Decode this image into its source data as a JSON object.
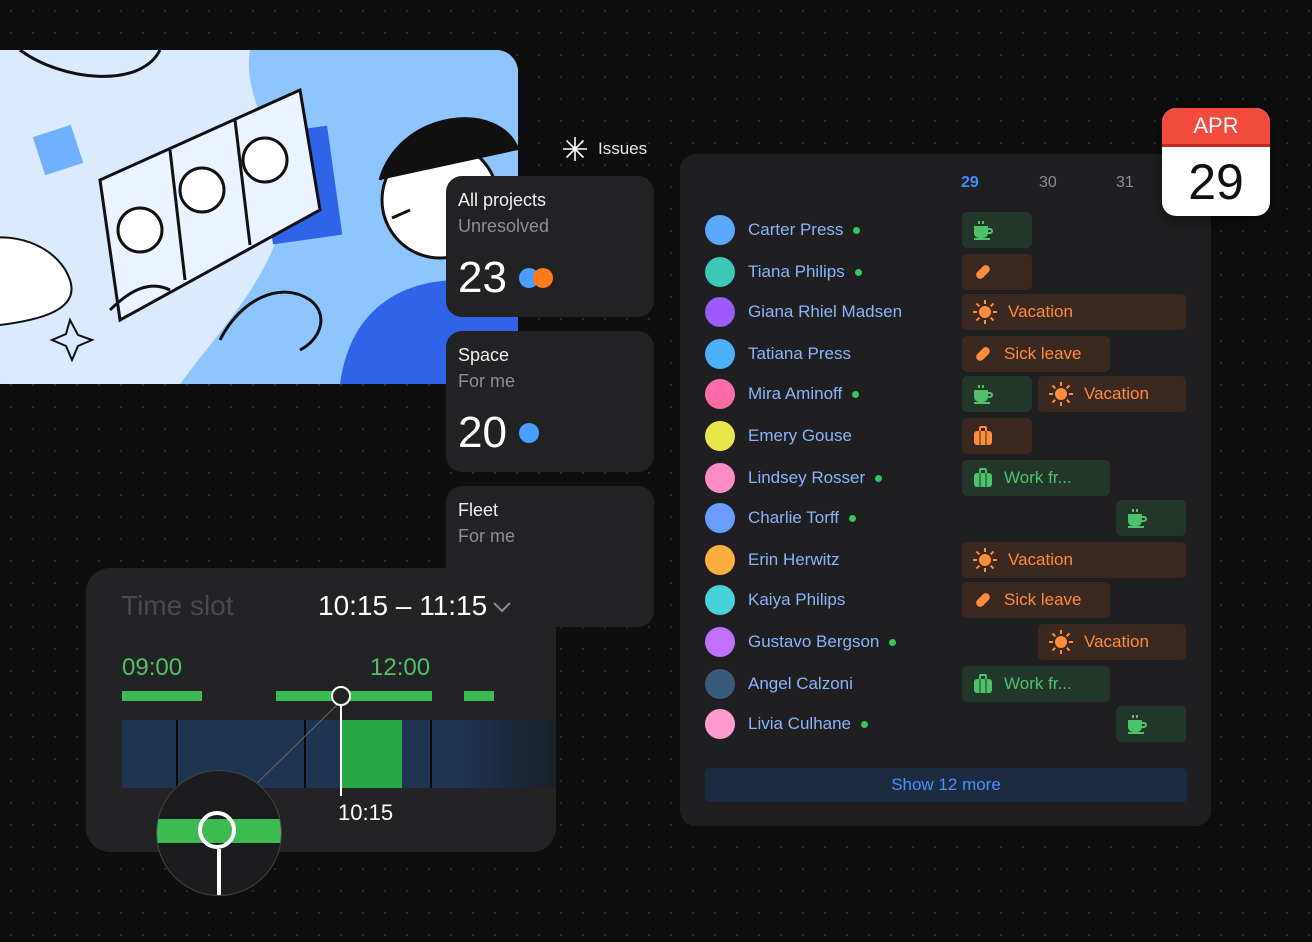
{
  "issues": {
    "label": "Issues",
    "cards": [
      {
        "title": "All projects",
        "subtitle": "Unresolved",
        "count": "23",
        "dots": [
          "#4a9eff",
          "#ff7a1a"
        ]
      },
      {
        "title": "Space",
        "subtitle": "For me",
        "count": "20",
        "dots": [
          "#4a9eff"
        ]
      },
      {
        "title": "Fleet",
        "subtitle": "For me",
        "count": "",
        "dots": []
      }
    ]
  },
  "calendar": {
    "days": [
      {
        "label": "29",
        "active": true
      },
      {
        "label": "30",
        "active": false
      },
      {
        "label": "31",
        "active": false
      }
    ],
    "people": [
      {
        "name": "Carter Press",
        "online": true,
        "avatar_color": "#5aa8ff"
      },
      {
        "name": "Tiana Philips",
        "online": true,
        "avatar_color": "#3cc8b4"
      },
      {
        "name": "Giana Rhiel Madsen",
        "online": false,
        "avatar_color": "#9b59ff"
      },
      {
        "name": "Tatiana Press",
        "online": false,
        "avatar_color": "#4ab0ff"
      },
      {
        "name": "Mira Aminoff",
        "online": true,
        "avatar_color": "#ff6aa8"
      },
      {
        "name": "Emery Gouse",
        "online": false,
        "avatar_color": "#e8e84a"
      },
      {
        "name": "Lindsey Rosser",
        "online": true,
        "avatar_color": "#ff8ac8"
      },
      {
        "name": "Charlie Torff",
        "online": true,
        "avatar_color": "#6a9cff"
      },
      {
        "name": "Erin Herwitz",
        "online": false,
        "avatar_color": "#ffb03a"
      },
      {
        "name": "Kaiya Philips",
        "online": false,
        "avatar_color": "#4ad0d8"
      },
      {
        "name": "Gustavo Bergson",
        "online": true,
        "avatar_color": "#c070ff"
      },
      {
        "name": "Angel Calzoni",
        "online": false,
        "avatar_color": "#3a5a7a"
      },
      {
        "name": "Livia Culhane",
        "online": true,
        "avatar_color": "#ff9ad0"
      }
    ],
    "events": [
      {
        "row": 0,
        "kind": "coffee",
        "color": "green",
        "label": ""
      },
      {
        "row": 1,
        "kind": "pill",
        "color": "orange",
        "label": ""
      },
      {
        "row": 2,
        "kind": "sun",
        "color": "orange",
        "label": "Vacation"
      },
      {
        "row": 3,
        "kind": "pill",
        "color": "orange",
        "label": "Sick leave"
      },
      {
        "row": 4,
        "kind": "coffee",
        "color": "green",
        "label": ""
      },
      {
        "row": 4,
        "kind": "sun",
        "color": "orange",
        "label": "Vacation"
      },
      {
        "row": 5,
        "kind": "bag",
        "color": "orange",
        "label": ""
      },
      {
        "row": 6,
        "kind": "bag",
        "color": "green",
        "label": "Work fr..."
      },
      {
        "row": 7,
        "kind": "coffee",
        "color": "green",
        "label": ""
      },
      {
        "row": 8,
        "kind": "sun",
        "color": "orange",
        "label": "Vacation"
      },
      {
        "row": 9,
        "kind": "pill",
        "color": "orange",
        "label": "Sick leave"
      },
      {
        "row": 10,
        "kind": "sun",
        "color": "orange",
        "label": "Vacation"
      },
      {
        "row": 11,
        "kind": "bag",
        "color": "green",
        "label": "Work fr..."
      },
      {
        "row": 12,
        "kind": "coffee",
        "color": "green",
        "label": ""
      }
    ],
    "show_more": "Show 12 more"
  },
  "date_badge": {
    "month": "APR",
    "day": "29"
  },
  "timeslot": {
    "label": "Time slot",
    "range": "10:15 – 11:15",
    "hour_start": "09:00",
    "hour_mid": "12:00",
    "handle_time": "10:15"
  }
}
